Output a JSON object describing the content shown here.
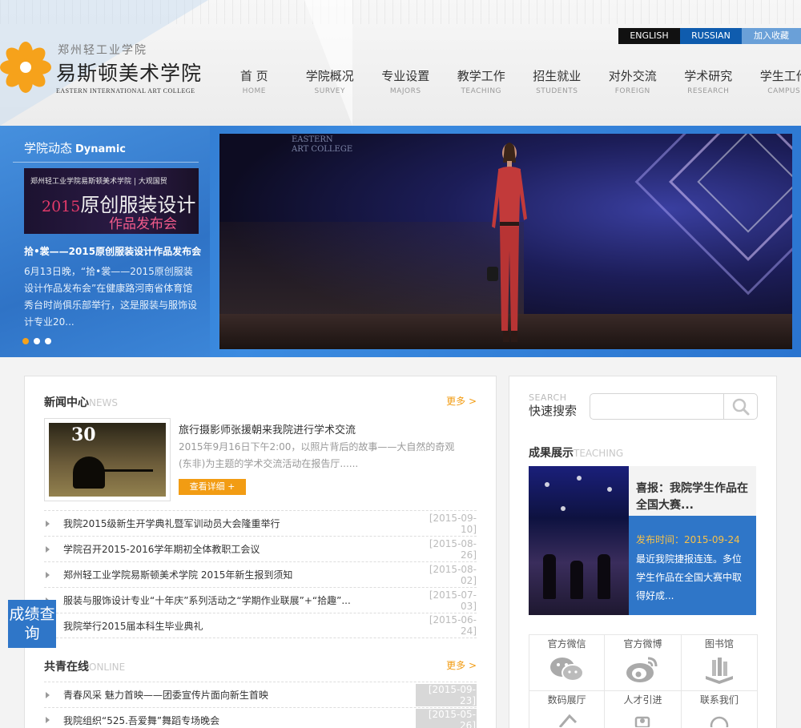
{
  "header": {
    "lang_buttons": [
      "ENGLISH",
      "RUSSIAN"
    ],
    "favorite_label": "加入收藏",
    "logo": {
      "cn_small": "郑州轻工业学院",
      "cn_big": "易斯顿美术学院",
      "en": "EASTERN INTERNATIONAL ART COLLEGE"
    },
    "nav": [
      {
        "cn": "首 页",
        "en": "HOME"
      },
      {
        "cn": "学院概况",
        "en": "SURVEY"
      },
      {
        "cn": "专业设置",
        "en": "MAJORS"
      },
      {
        "cn": "教学工作",
        "en": "TEACHING"
      },
      {
        "cn": "招生就业",
        "en": "STUDENTS"
      },
      {
        "cn": "对外交流",
        "en": "FOREIGN"
      },
      {
        "cn": "学术研究",
        "en": "RESEARCH"
      },
      {
        "cn": "学生工作",
        "en": "CAMPUS"
      }
    ]
  },
  "dynamic": {
    "title_cn": "学院动态",
    "title_en": "Dynamic",
    "image_small": "郑州轻工业学院易斯顿美术学院 | 大观国贸",
    "image_year": "2015",
    "image_big": "原创服装设计",
    "image_sub": "作品发布会",
    "headline": "拾•裳——2015原创服装设计作品发布会",
    "text": "6月13日晚，“拾•裳——2015原创服装设计作品发布会”在健康路河南省体育馆秀台时尚俱乐部举行，这是服装与服饰设计专业20..."
  },
  "hero": {
    "brand": "EASTERN\nART COLLEGE"
  },
  "news": {
    "title_cn": "新闻中心",
    "title_en": "NEWS",
    "more": "更多 >",
    "featured": {
      "title": "旅行摄影师张援朝来我院进行学术交流",
      "desc": "2015年9月16日下午2:00，以照片背后的故事——大自然的奇观(东非)为主题的学术交流活动在报告厅......",
      "button": "查看详细 +",
      "img_number": "30"
    },
    "items": [
      {
        "title": "我院2015级新生开学典礼暨军训动员大会隆重举行",
        "date": "[2015-09-10]"
      },
      {
        "title": "学院召开2015-2016学年期初全体教职工会议",
        "date": "[2015-08-26]"
      },
      {
        "title": "郑州轻工业学院易斯顿美术学院 2015年新生报到须知",
        "date": "[2015-08-02]"
      },
      {
        "title": "服装与服饰设计专业“十年庆”系列活动之“学期作业联展”+“拾趣”...",
        "date": "[2015-07-03]"
      },
      {
        "title": "我院举行2015届本科生毕业典礼",
        "date": "[2015-06-24]"
      }
    ]
  },
  "youth": {
    "title_cn": "共青在线",
    "title_en": "ONLINE",
    "more": "更多 >",
    "items": [
      {
        "title": "青春风采 魅力首映——团委宣传片面向新生首映",
        "date": "[2015-09-23]"
      },
      {
        "title": "我院组织“525.吾爱舞”舞蹈专场晚会",
        "date": "[2015-05-26]"
      }
    ]
  },
  "score_badge": "成绩查询",
  "search": {
    "label_en": "SEARCH",
    "label_cn": "快速搜索",
    "placeholder": "",
    "icon": "magnifier-icon"
  },
  "achievement": {
    "title_cn": "成果展示",
    "title_en": "TEACHING",
    "card_title": "喜报：我院学生作品在全国大赛...",
    "time": "发布时间：2015-09-24",
    "desc": "最近我院捷报连连。多位学生作品在全国大赛中取得好成..."
  },
  "quick_links": [
    {
      "label": "官方微信",
      "icon": "wechat-icon"
    },
    {
      "label": "官方微博",
      "icon": "weibo-icon"
    },
    {
      "label": "图书馆",
      "icon": "library-icon"
    },
    {
      "label": "数码展厅",
      "icon": "gallery-icon"
    },
    {
      "label": "人才引进",
      "icon": "talent-icon"
    },
    {
      "label": "联系我们",
      "icon": "contact-icon"
    }
  ],
  "colors": {
    "accent_blue": "#2f76c8",
    "accent_orange": "#f29c13",
    "logo_orange": "#f6a21b"
  }
}
